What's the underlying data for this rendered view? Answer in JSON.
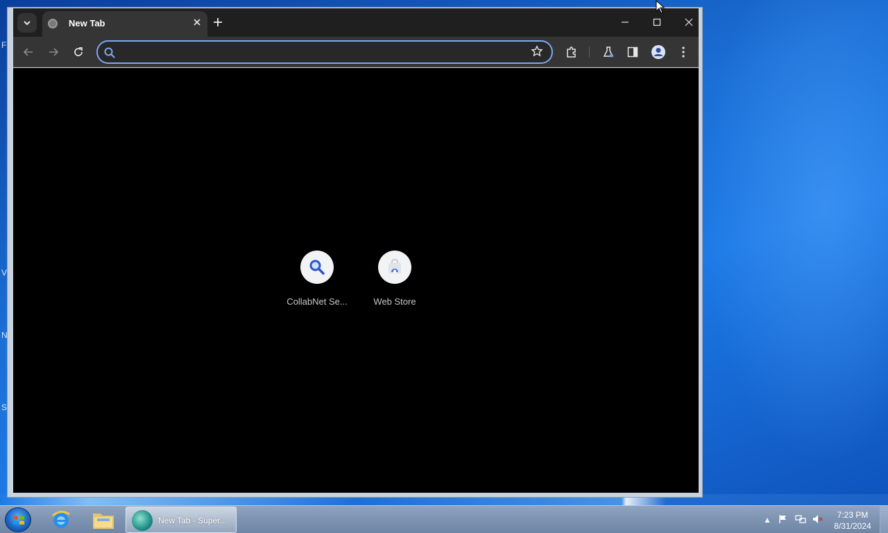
{
  "desktop": {
    "edge_letters": [
      "F",
      "V",
      "N",
      "S"
    ]
  },
  "browser": {
    "tab": {
      "title": "New Tab",
      "favicon": "globe-icon"
    },
    "window_controls": [
      "minimize",
      "maximize",
      "close"
    ],
    "toolbar": {
      "omnibox_value": "",
      "icons": [
        "back-icon",
        "forward-icon",
        "reload-icon",
        "search-icon",
        "bookmark-star-icon",
        "extensions-icon",
        "labs-flask-icon",
        "side-panel-icon",
        "profile-icon",
        "menu-kebab-icon"
      ]
    },
    "shortcuts": [
      {
        "label": "CollabNet Se...",
        "icon": "magnifier-icon"
      },
      {
        "label": "Web Store",
        "icon": "web-store-icon"
      }
    ],
    "accent_color": "#7ea7f5"
  },
  "taskbar": {
    "pinned": [
      "internet-explorer-icon",
      "file-explorer-icon"
    ],
    "active_task": {
      "label": "New Tab - Super..."
    },
    "clock": {
      "time": "7:23 PM",
      "date": "8/31/2024"
    }
  }
}
